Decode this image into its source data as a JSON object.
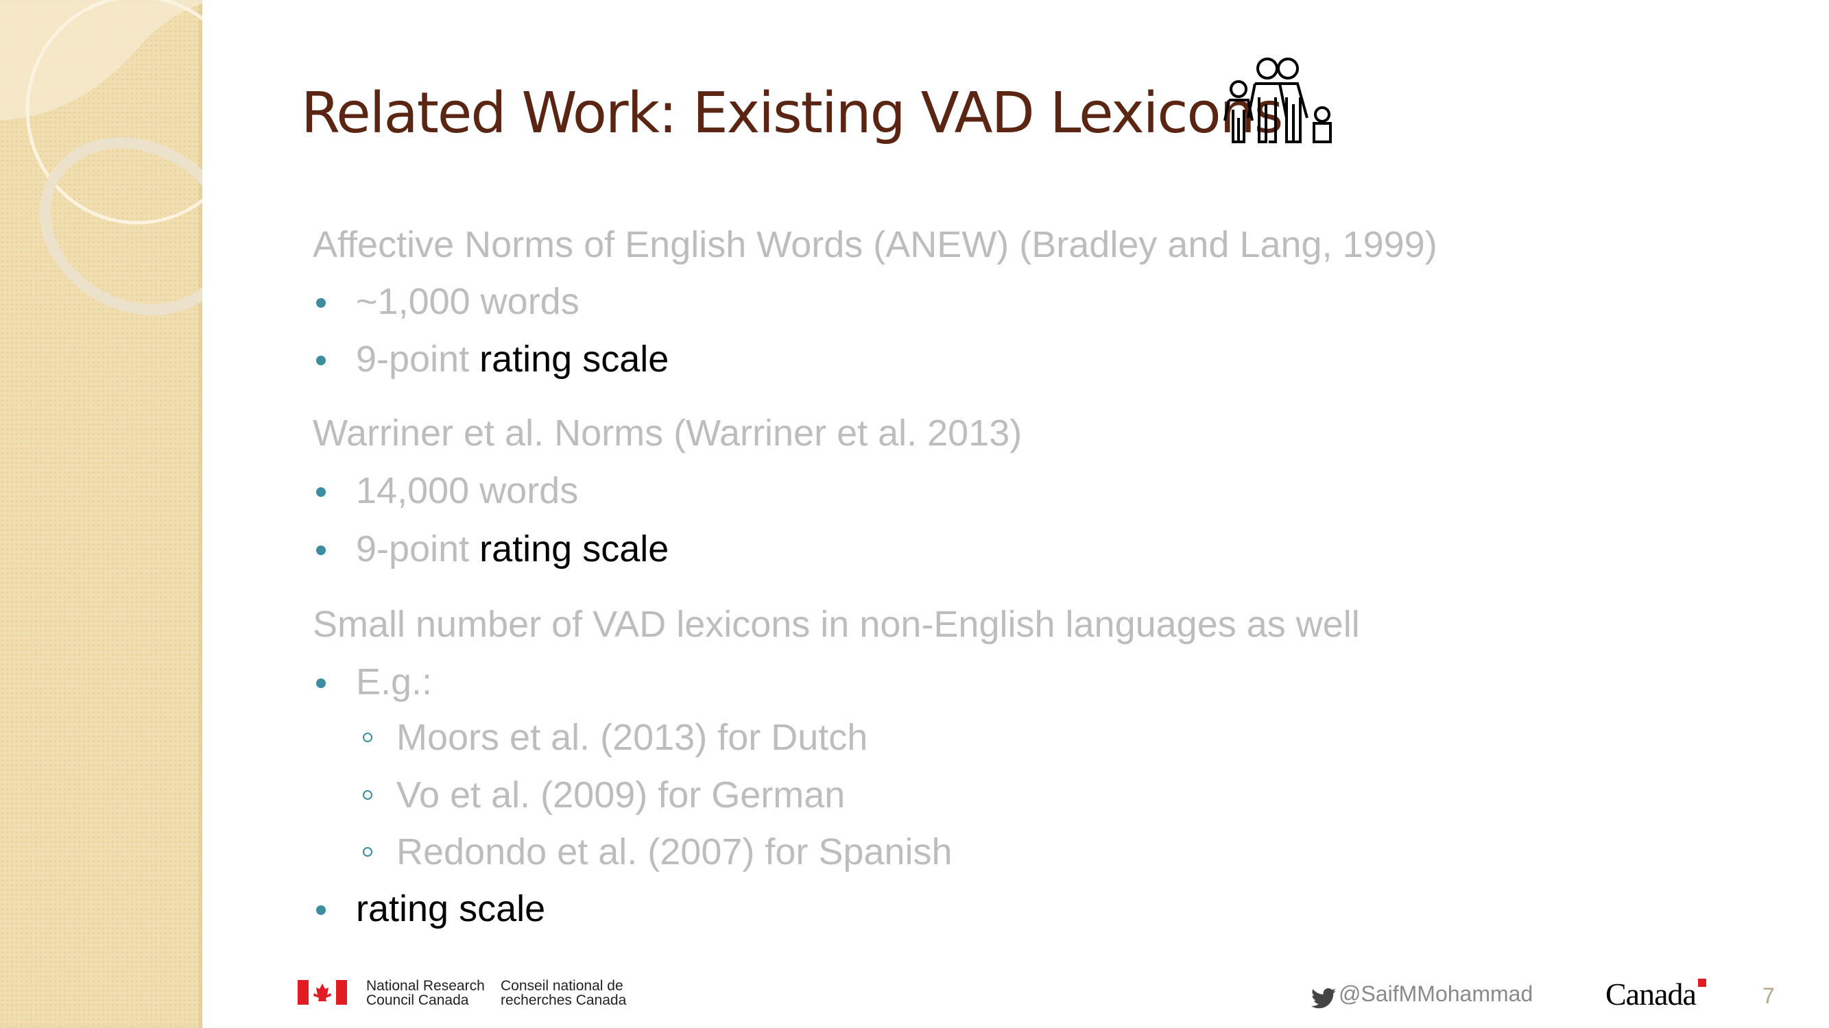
{
  "slide": {
    "title": "Related Work: Existing VAD Lexicons",
    "title_icon": "family-icon",
    "sections": [
      {
        "heading": "Affective Norms of English Words (ANEW) (Bradley and Lang, 1999)",
        "bullets": [
          {
            "text": "~1,000 words"
          },
          {
            "gray": "9-point",
            "black": " rating scale"
          }
        ]
      },
      {
        "heading": "Warriner et al. Norms (Warriner et al. 2013)",
        "bullets": [
          {
            "text": "14,000 words"
          },
          {
            "gray": "9-point",
            "black": " rating scale"
          }
        ]
      },
      {
        "heading": "Small number of VAD lexicons in non-English languages as well",
        "bullets": [
          {
            "text": "E.g.:",
            "sub": [
              "Moors et al. (2013) for Dutch",
              "Vo et al. (2009) for German",
              "Redondo et al. (2007) for Spanish"
            ]
          },
          {
            "black": "rating scale"
          }
        ]
      }
    ]
  },
  "footer": {
    "nrc_en": [
      "National Research",
      "Council Canada"
    ],
    "nrc_fr": [
      "Conseil national de",
      "recherches Canada"
    ],
    "twitter": "@SaifMMohammad",
    "wordmark": "Canada",
    "page_number": "7"
  },
  "colors": {
    "title": "#5a2512",
    "bullet": "#3b8ea0",
    "gray_text": "#bdbdbd",
    "strip": "#f1deb0"
  }
}
